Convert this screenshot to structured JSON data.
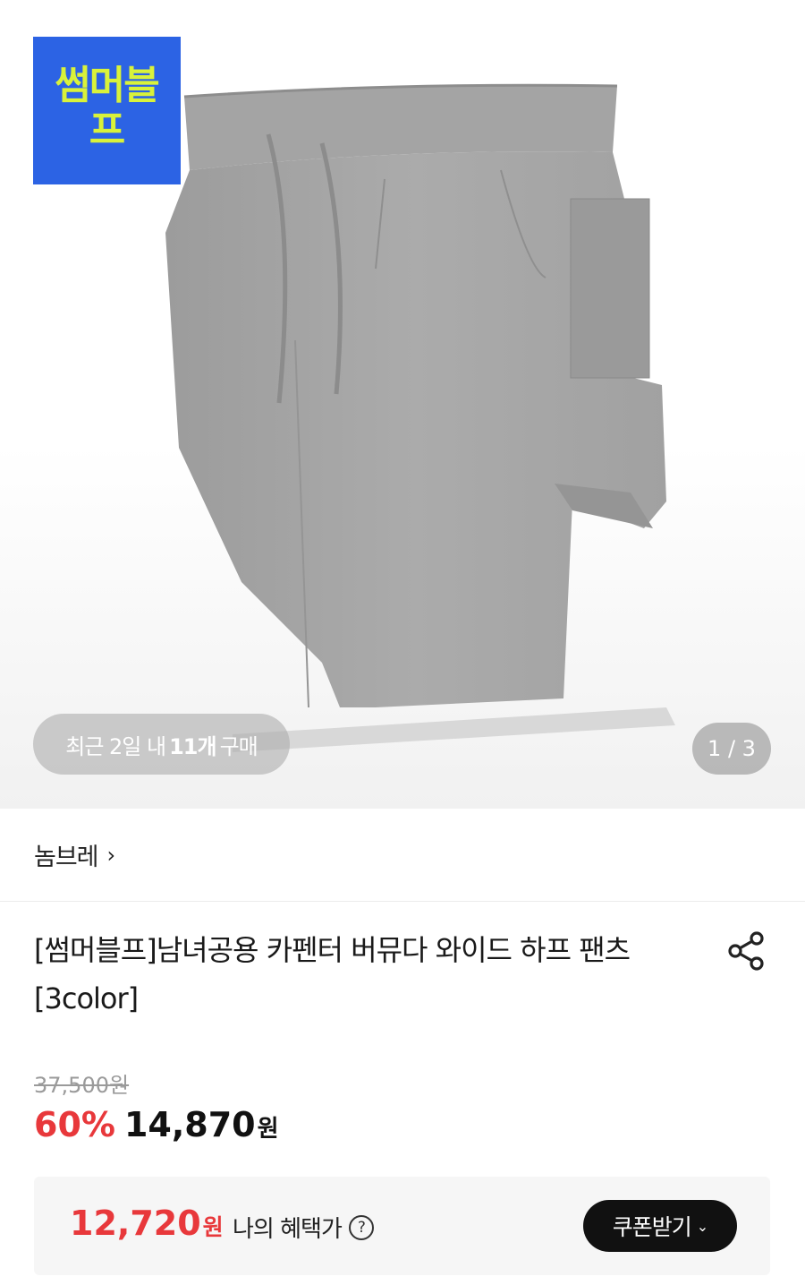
{
  "hero": {
    "badge_text": "썸머블프",
    "recent_prefix": "최근 2일 내",
    "recent_count": "11개",
    "recent_suffix": "구매",
    "page_indicator": "1 / 3"
  },
  "brand": {
    "name": "놈브레",
    "chevron": "›"
  },
  "product": {
    "title": "[썸머블프]남녀공용 카펜터 버뮤다 와이드 하프 팬츠 [3color]"
  },
  "price": {
    "original": "37,500원",
    "discount": "60%",
    "sale": "14,870",
    "sale_unit": "원"
  },
  "benefit": {
    "amount": "12,720",
    "amount_unit": "원",
    "label": "나의 혜택가",
    "help": "?",
    "coupon_button": "쿠폰받기",
    "coupon_arrow": "⌄"
  },
  "colors": {
    "accent_red": "#e8383b",
    "badge_blue": "#2c63e4",
    "badge_text": "#d9f23a"
  },
  "icons": [
    "share-icon",
    "help-icon",
    "chevron-right-icon",
    "chevron-down-icon"
  ]
}
